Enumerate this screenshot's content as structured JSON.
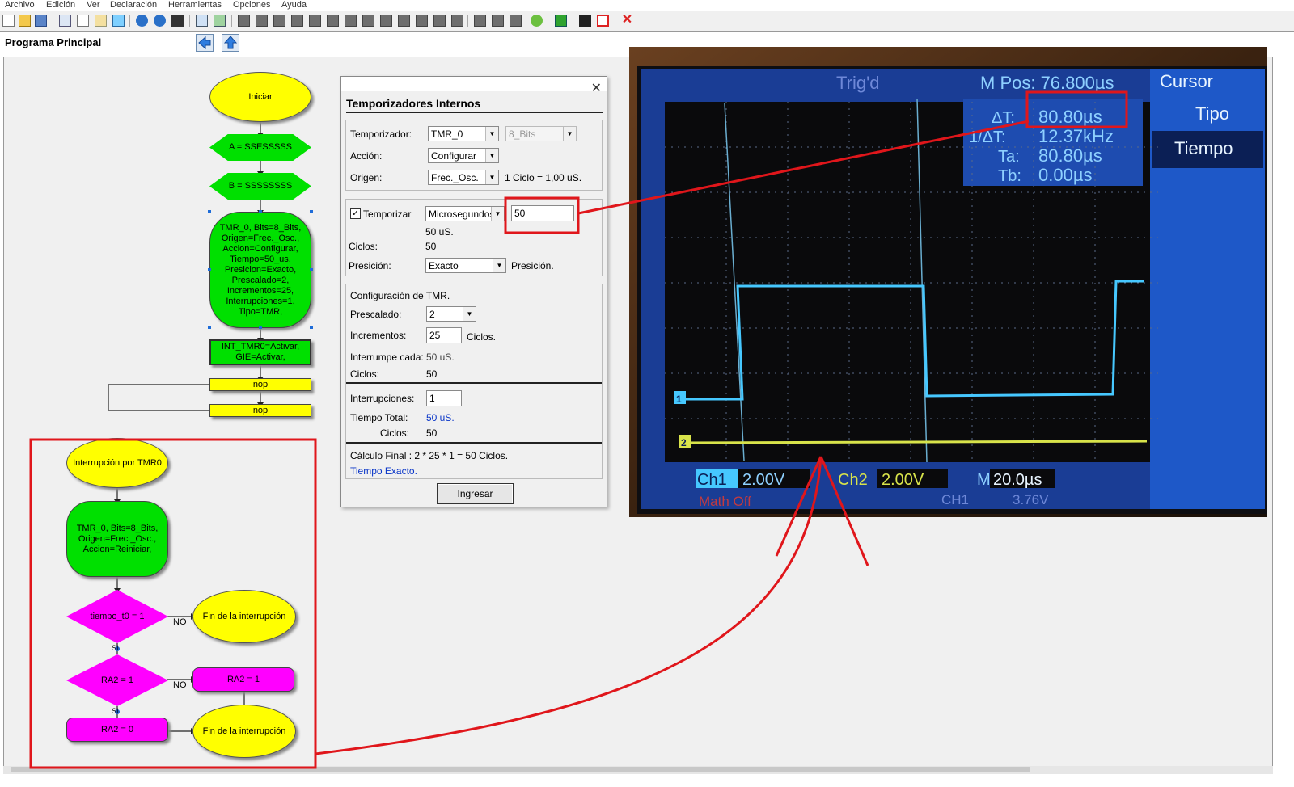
{
  "menu": [
    "Archivo",
    "Edición",
    "Ver",
    "Declaración",
    "Herramientas",
    "Opciones",
    "Ayuda"
  ],
  "page_title": "Programa Principal",
  "flow": {
    "start": "Iniciar",
    "assign_a": "A = SSESSSSS",
    "assign_b": "B = SSSSSSSS",
    "tmr_config": [
      "TMR_0, Bits=8_Bits,",
      "Origen=Frec._Osc.,",
      "Accion=Configurar,",
      "Tiempo=50_us,",
      "Presicion=Exacto,",
      "Prescalado=2,",
      "Incrementos=25,",
      "Interrupciones=1,",
      "Tipo=TMR,"
    ],
    "int_block": [
      "INT_TMR0=Activar,",
      "GIE=Activar,"
    ],
    "nop1": "nop",
    "nop2": "nop",
    "isr_start": "Interrupción por TMR0",
    "tmr_reset": [
      "TMR_0, Bits=8_Bits,",
      "Origen=Frec._Osc.,",
      "Accion=Reiniciar,"
    ],
    "cond1": "tiempo_t0 = 1",
    "end1": "Fin de la interrupción",
    "no1": "NO",
    "cond2": "RA2 = 1",
    "set_ra2": "RA2 = 1",
    "no2": "NO",
    "clr_ra2": "RA2 = 0",
    "end2": "Fin de la interrupción",
    "si1": "SI",
    "si2": "SI"
  },
  "dialog": {
    "title": "Temporizadores Internos",
    "temporizador_label": "Temporizador:",
    "temporizador_value": "TMR_0",
    "bits_value": "8_Bits",
    "accion_label": "Acción:",
    "accion_value": "Configurar",
    "origen_label": "Origen:",
    "origen_value": "Frec._Osc.",
    "ciclo_info": "1 Ciclo = 1,00 uS.",
    "temporizar_label": "Temporizar",
    "temporizar_checked": "✓",
    "unidad_value": "Microsegundos",
    "tiempo_value": "50",
    "tiempo_us": "50 uS.",
    "ciclos_label": "Ciclos:",
    "ciclos_value": "50",
    "presicion_label": "Presición:",
    "presicion_value": "Exacto",
    "presicion_suffix": "Presición.",
    "config_label": "Configuración de TMR.",
    "prescalado_label": "Prescalado:",
    "prescalado_value": "2",
    "incrementos_label": "Incrementos:",
    "incrementos_value": "25",
    "incrementos_suffix": "Ciclos.",
    "interrumpe_label": "Interrumpe cada:",
    "interrumpe_value": "50 uS.",
    "ciclos2_label": "Ciclos:",
    "ciclos2_value": "50",
    "interrupciones_label": "Interrupciones:",
    "interrupciones_value": "1",
    "tiempo_total_label": "Tiempo Total:",
    "tiempo_total_value": "50 uS.",
    "ciclos3_label": "Ciclos:",
    "ciclos3_value": "50",
    "calculo": "Cálculo Final : 2 * 25 * 1 = 50 Ciclos.",
    "tiempo_exacto": "Tiempo Exacto.",
    "ingresar": "Ingresar",
    "close": "✕"
  },
  "scope": {
    "trig": "Trig'd",
    "mpos": "M Pos: 76.800µs",
    "cursor": "Cursor",
    "tipo": "Tipo",
    "tiempo": "Tiempo",
    "delta_t": "ΔT:",
    "delta_t_value": "80.80µs",
    "inv_dt": "1/ΔT:",
    "inv_dt_value": "12.37kHz",
    "ta": "Ta:",
    "ta_value": "80.80µs",
    "tb": "Tb:",
    "tb_value": "0.00µs",
    "ch1": "Ch1",
    "ch1_v": "2.00V",
    "ch2": "Ch2",
    "ch2_v": "2.00V",
    "m": "M",
    "m_v": "20.0µs",
    "math": "Math  Off",
    "trig_src": "CH1",
    "trig_v": "3.76V",
    "marker1": "1",
    "marker2": "2"
  },
  "colors": {
    "highlight_red": "#e0161b",
    "flow_green": "#00e000",
    "flow_yellow": "#ffff00",
    "flow_magenta": "#ff00ff",
    "scope_blue": "#1b3f9a",
    "trace_cyan": "#46c8ff",
    "trace_yellow": "#d8e34a"
  }
}
